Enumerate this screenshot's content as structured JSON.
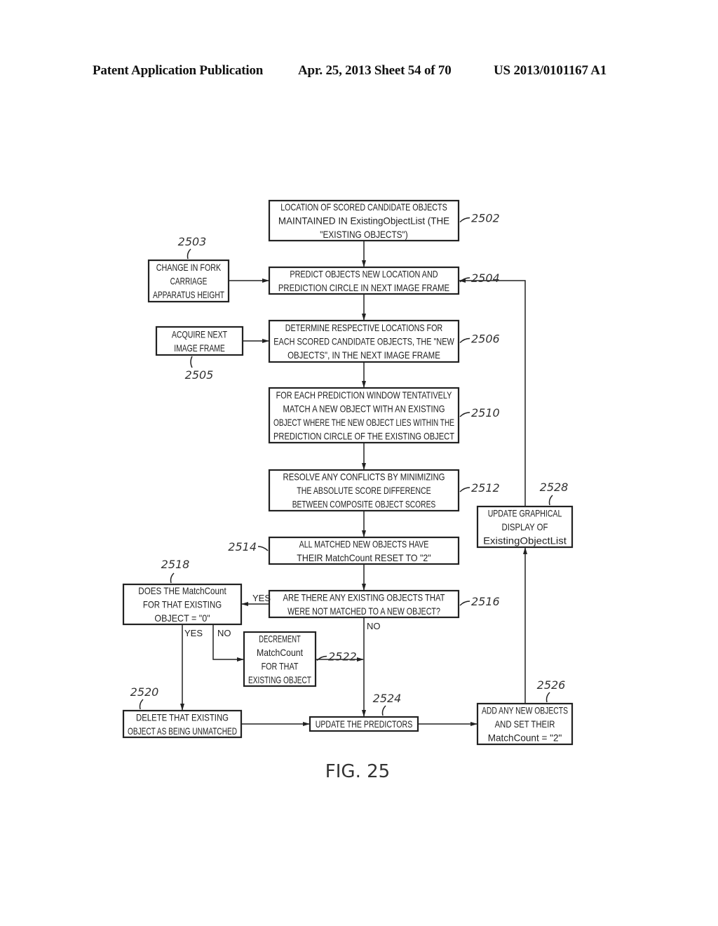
{
  "header": {
    "left": "Patent Application Publication",
    "middle": "Apr. 25, 2013  Sheet 54 of 70",
    "right": "US 2013/0101167 A1"
  },
  "figure_label": "FIG. 25",
  "nodes": {
    "n2502": {
      "ref": "2502",
      "lines": [
        "LOCATION OF SCORED CANDIDATE OBJECTS",
        "MAINTAINED IN ExistingObjectList (THE",
        "\"EXISTING OBJECTS\")"
      ]
    },
    "n2503": {
      "ref": "2503",
      "lines": [
        "CHANGE IN FORK",
        "CARRIAGE",
        "APPARATUS HEIGHT"
      ]
    },
    "n2504": {
      "ref": "2504",
      "lines": [
        "PREDICT OBJECTS NEW LOCATION AND",
        "PREDICTION CIRCLE IN NEXT IMAGE FRAME"
      ]
    },
    "n2505": {
      "ref": "2505",
      "lines": [
        "ACQUIRE NEXT",
        "IMAGE FRAME"
      ]
    },
    "n2506": {
      "ref": "2506",
      "lines": [
        "DETERMINE RESPECTIVE LOCATIONS FOR",
        "EACH SCORED CANDIDATE OBJECTS, THE \"NEW",
        "OBJECTS\", IN THE NEXT IMAGE FRAME"
      ]
    },
    "n2510": {
      "ref": "2510",
      "lines": [
        "FOR EACH PREDICTION WINDOW TENTATIVELY",
        "MATCH A NEW OBJECT WITH AN EXISTING",
        "OBJECT WHERE THE NEW OBJECT LIES WITHIN THE",
        "PREDICTION CIRCLE OF THE EXISTING OBJECT"
      ]
    },
    "n2512": {
      "ref": "2512",
      "lines": [
        "RESOLVE ANY CONFLICTS BY MINIMIZING",
        "THE ABSOLUTE SCORE DIFFERENCE",
        "BETWEEN COMPOSITE OBJECT SCORES"
      ]
    },
    "n2514": {
      "ref": "2514",
      "lines": [
        "ALL MATCHED NEW OBJECTS HAVE",
        "THEIR MatchCount RESET TO \"2\""
      ]
    },
    "n2516": {
      "ref": "2516",
      "lines": [
        "ARE THERE ANY EXISTING OBJECTS THAT",
        "WERE NOT MATCHED TO A NEW OBJECT?"
      ]
    },
    "n2518": {
      "ref": "2518",
      "lines": [
        "DOES THE MatchCount",
        "FOR THAT EXISTING",
        "OBJECT = \"0\""
      ]
    },
    "n2520": {
      "ref": "2520",
      "lines": [
        "DELETE THAT EXISTING",
        "OBJECT AS BEING UNMATCHED"
      ]
    },
    "n2522": {
      "ref": "2522",
      "lines": [
        "DECREMENT",
        "MatchCount",
        "FOR THAT",
        "EXISTING OBJECT"
      ]
    },
    "n2524": {
      "ref": "2524",
      "lines": [
        "UPDATE THE PREDICTORS"
      ]
    },
    "n2526": {
      "ref": "2526",
      "lines": [
        "ADD ANY NEW OBJECTS",
        "AND SET THEIR",
        "MatchCount = \"2\""
      ]
    },
    "n2528": {
      "ref": "2528",
      "lines": [
        "UPDATE GRAPHICAL",
        "DISPLAY OF",
        "ExistingObjectList"
      ]
    }
  },
  "edge_labels": {
    "yes_2516": "YES",
    "no_2516": "NO",
    "yes_2518": "YES",
    "no_2518": "NO"
  }
}
